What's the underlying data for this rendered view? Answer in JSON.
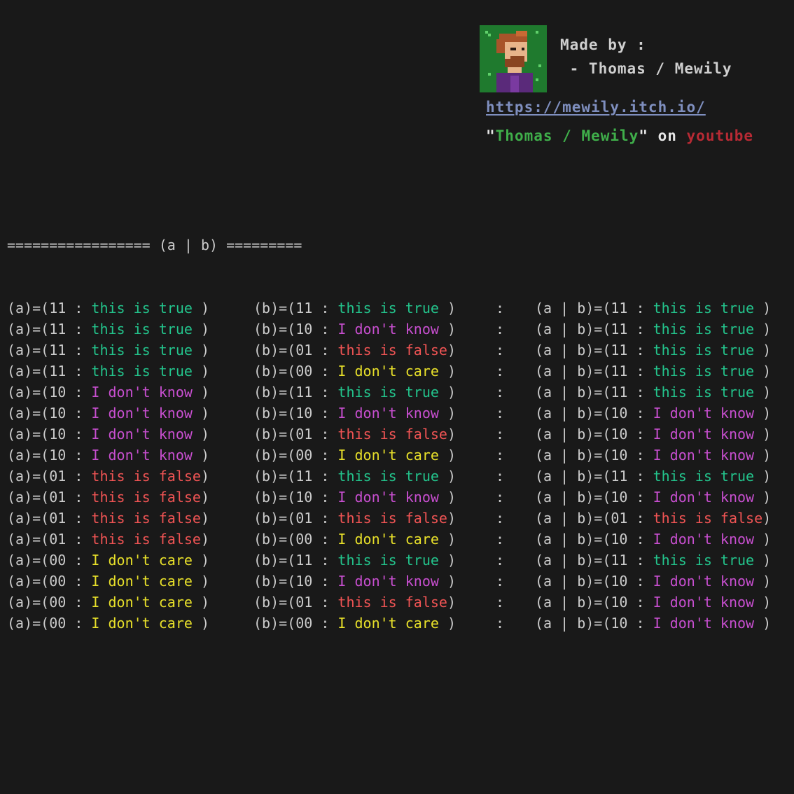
{
  "credits": {
    "made_by": "Made by :",
    "author_line": " - Thomas / Mewily",
    "link": "https://mewily.itch.io/",
    "channel_prefix": "\"",
    "channel_name": "Thomas / Mewily",
    "channel_mid": "\" on ",
    "channel_platform": "youtube",
    "avatar_icon": "pixel-portrait-avatar"
  },
  "colors": {
    "background": "#191919",
    "text": "#cccccc",
    "true": "#23c48c",
    "dont_know": "#c84fd0",
    "false": "#f05454",
    "dont_care": "#e8e02a"
  },
  "table": {
    "header": "================= (a | b) =========",
    "rows": [
      {
        "a_pre": "(a)=(11 : ",
        "a_val": "this is true",
        "a_cls": "true",
        "a_end": " )",
        "b_pre": "(b)=(11 : ",
        "b_val": "this is true",
        "b_cls": "true",
        "b_end": " )",
        "sep": ":",
        "r_pre": "(a | b)=(11 : ",
        "r_val": "this is true",
        "r_cls": "true",
        "r_end": " )"
      },
      {
        "a_pre": "(a)=(11 : ",
        "a_val": "this is true",
        "a_cls": "true",
        "a_end": " )",
        "b_pre": "(b)=(10 : ",
        "b_val": "I don't know",
        "b_cls": "know",
        "b_end": " )",
        "sep": ":",
        "r_pre": "(a | b)=(11 : ",
        "r_val": "this is true",
        "r_cls": "true",
        "r_end": " )"
      },
      {
        "a_pre": "(a)=(11 : ",
        "a_val": "this is true",
        "a_cls": "true",
        "a_end": " )",
        "b_pre": "(b)=(01 : ",
        "b_val": "this is false",
        "b_cls": "false",
        "b_end": ")",
        "sep": ":",
        "r_pre": "(a | b)=(11 : ",
        "r_val": "this is true",
        "r_cls": "true",
        "r_end": " )"
      },
      {
        "a_pre": "(a)=(11 : ",
        "a_val": "this is true",
        "a_cls": "true",
        "a_end": " )",
        "b_pre": "(b)=(00 : ",
        "b_val": "I don't care",
        "b_cls": "care",
        "b_end": " )",
        "sep": ":",
        "r_pre": "(a | b)=(11 : ",
        "r_val": "this is true",
        "r_cls": "true",
        "r_end": " )"
      },
      {
        "a_pre": "(a)=(10 : ",
        "a_val": "I don't know",
        "a_cls": "know",
        "a_end": " )",
        "b_pre": "(b)=(11 : ",
        "b_val": "this is true",
        "b_cls": "true",
        "b_end": " )",
        "sep": ":",
        "r_pre": "(a | b)=(11 : ",
        "r_val": "this is true",
        "r_cls": "true",
        "r_end": " )"
      },
      {
        "a_pre": "(a)=(10 : ",
        "a_val": "I don't know",
        "a_cls": "know",
        "a_end": " )",
        "b_pre": "(b)=(10 : ",
        "b_val": "I don't know",
        "b_cls": "know",
        "b_end": " )",
        "sep": ":",
        "r_pre": "(a | b)=(10 : ",
        "r_val": "I don't know",
        "r_cls": "know",
        "r_end": " )"
      },
      {
        "a_pre": "(a)=(10 : ",
        "a_val": "I don't know",
        "a_cls": "know",
        "a_end": " )",
        "b_pre": "(b)=(01 : ",
        "b_val": "this is false",
        "b_cls": "false",
        "b_end": ")",
        "sep": ":",
        "r_pre": "(a | b)=(10 : ",
        "r_val": "I don't know",
        "r_cls": "know",
        "r_end": " )"
      },
      {
        "a_pre": "(a)=(10 : ",
        "a_val": "I don't know",
        "a_cls": "know",
        "a_end": " )",
        "b_pre": "(b)=(00 : ",
        "b_val": "I don't care",
        "b_cls": "care",
        "b_end": " )",
        "sep": ":",
        "r_pre": "(a | b)=(10 : ",
        "r_val": "I don't know",
        "r_cls": "know",
        "r_end": " )"
      },
      {
        "a_pre": "(a)=(01 : ",
        "a_val": "this is false",
        "a_cls": "false",
        "a_end": ")",
        "b_pre": "(b)=(11 : ",
        "b_val": "this is true",
        "b_cls": "true",
        "b_end": " )",
        "sep": ":",
        "r_pre": "(a | b)=(11 : ",
        "r_val": "this is true",
        "r_cls": "true",
        "r_end": " )"
      },
      {
        "a_pre": "(a)=(01 : ",
        "a_val": "this is false",
        "a_cls": "false",
        "a_end": ")",
        "b_pre": "(b)=(10 : ",
        "b_val": "I don't know",
        "b_cls": "know",
        "b_end": " )",
        "sep": ":",
        "r_pre": "(a | b)=(10 : ",
        "r_val": "I don't know",
        "r_cls": "know",
        "r_end": " )"
      },
      {
        "a_pre": "(a)=(01 : ",
        "a_val": "this is false",
        "a_cls": "false",
        "a_end": ")",
        "b_pre": "(b)=(01 : ",
        "b_val": "this is false",
        "b_cls": "false",
        "b_end": ")",
        "sep": ":",
        "r_pre": "(a | b)=(01 : ",
        "r_val": "this is false",
        "r_cls": "false",
        "r_end": ")"
      },
      {
        "a_pre": "(a)=(01 : ",
        "a_val": "this is false",
        "a_cls": "false",
        "a_end": ")",
        "b_pre": "(b)=(00 : ",
        "b_val": "I don't care",
        "b_cls": "care",
        "b_end": " )",
        "sep": ":",
        "r_pre": "(a | b)=(10 : ",
        "r_val": "I don't know",
        "r_cls": "know",
        "r_end": " )"
      },
      {
        "a_pre": "(a)=(00 : ",
        "a_val": "I don't care",
        "a_cls": "care",
        "a_end": " )",
        "b_pre": "(b)=(11 : ",
        "b_val": "this is true",
        "b_cls": "true",
        "b_end": " )",
        "sep": ":",
        "r_pre": "(a | b)=(11 : ",
        "r_val": "this is true",
        "r_cls": "true",
        "r_end": " )"
      },
      {
        "a_pre": "(a)=(00 : ",
        "a_val": "I don't care",
        "a_cls": "care",
        "a_end": " )",
        "b_pre": "(b)=(10 : ",
        "b_val": "I don't know",
        "b_cls": "know",
        "b_end": " )",
        "sep": ":",
        "r_pre": "(a | b)=(10 : ",
        "r_val": "I don't know",
        "r_cls": "know",
        "r_end": " )"
      },
      {
        "a_pre": "(a)=(00 : ",
        "a_val": "I don't care",
        "a_cls": "care",
        "a_end": " )",
        "b_pre": "(b)=(01 : ",
        "b_val": "this is false",
        "b_cls": "false",
        "b_end": ")",
        "sep": ":",
        "r_pre": "(a | b)=(10 : ",
        "r_val": "I don't know",
        "r_cls": "know",
        "r_end": " )"
      },
      {
        "a_pre": "(a)=(00 : ",
        "a_val": "I don't care",
        "a_cls": "care",
        "a_end": " )",
        "b_pre": "(b)=(00 : ",
        "b_val": "I don't care",
        "b_cls": "care",
        "b_end": " )",
        "sep": ":",
        "r_pre": "(a | b)=(10 : ",
        "r_val": "I don't know",
        "r_cls": "know",
        "r_end": " )"
      }
    ]
  }
}
